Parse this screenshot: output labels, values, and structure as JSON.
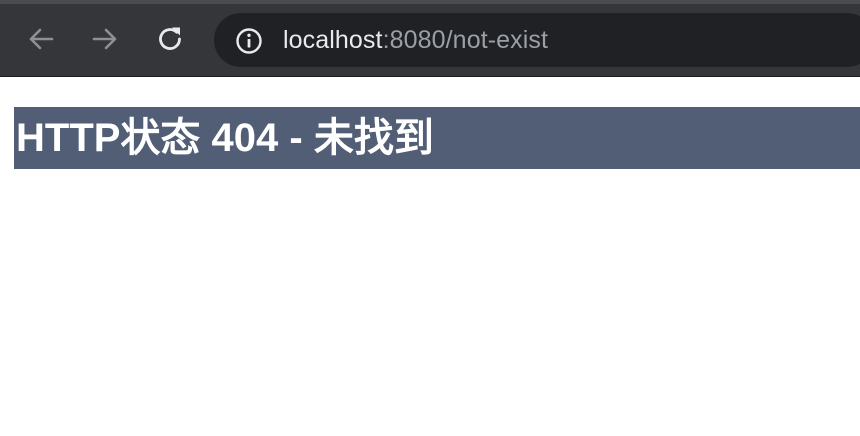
{
  "browser": {
    "icons": {
      "back": "arrow-left-icon",
      "forward": "arrow-right-icon",
      "reload": "reload-icon",
      "site_info": "info-circle-icon"
    },
    "address": {
      "host": "localhost",
      "rest": ":8080/not-exist"
    },
    "colors": {
      "toolbar": "#35363a",
      "omnibox": "#202124",
      "host_text": "#e8eaed",
      "path_text": "#9aa0a6",
      "icon_disabled": "#8e9094",
      "icon_enabled": "#e8eaed"
    }
  },
  "page": {
    "heading": "HTTP状态 404 - 未找到",
    "colors": {
      "heading_bg": "#525d76",
      "heading_text": "#ffffff",
      "background": "#ffffff"
    }
  }
}
